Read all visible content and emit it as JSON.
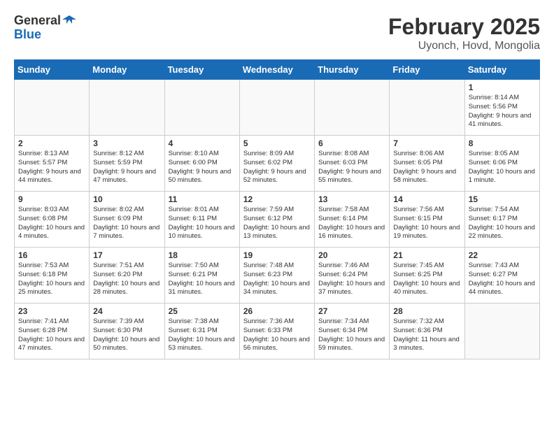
{
  "header": {
    "logo_line1": "General",
    "logo_line2": "Blue",
    "title": "February 2025",
    "subtitle": "Uyonch, Hovd, Mongolia"
  },
  "weekdays": [
    "Sunday",
    "Monday",
    "Tuesday",
    "Wednesday",
    "Thursday",
    "Friday",
    "Saturday"
  ],
  "weeks": [
    [
      {
        "day": "",
        "info": ""
      },
      {
        "day": "",
        "info": ""
      },
      {
        "day": "",
        "info": ""
      },
      {
        "day": "",
        "info": ""
      },
      {
        "day": "",
        "info": ""
      },
      {
        "day": "",
        "info": ""
      },
      {
        "day": "1",
        "info": "Sunrise: 8:14 AM\nSunset: 5:56 PM\nDaylight: 9 hours and 41 minutes."
      }
    ],
    [
      {
        "day": "2",
        "info": "Sunrise: 8:13 AM\nSunset: 5:57 PM\nDaylight: 9 hours and 44 minutes."
      },
      {
        "day": "3",
        "info": "Sunrise: 8:12 AM\nSunset: 5:59 PM\nDaylight: 9 hours and 47 minutes."
      },
      {
        "day": "4",
        "info": "Sunrise: 8:10 AM\nSunset: 6:00 PM\nDaylight: 9 hours and 50 minutes."
      },
      {
        "day": "5",
        "info": "Sunrise: 8:09 AM\nSunset: 6:02 PM\nDaylight: 9 hours and 52 minutes."
      },
      {
        "day": "6",
        "info": "Sunrise: 8:08 AM\nSunset: 6:03 PM\nDaylight: 9 hours and 55 minutes."
      },
      {
        "day": "7",
        "info": "Sunrise: 8:06 AM\nSunset: 6:05 PM\nDaylight: 9 hours and 58 minutes."
      },
      {
        "day": "8",
        "info": "Sunrise: 8:05 AM\nSunset: 6:06 PM\nDaylight: 10 hours and 1 minute."
      }
    ],
    [
      {
        "day": "9",
        "info": "Sunrise: 8:03 AM\nSunset: 6:08 PM\nDaylight: 10 hours and 4 minutes."
      },
      {
        "day": "10",
        "info": "Sunrise: 8:02 AM\nSunset: 6:09 PM\nDaylight: 10 hours and 7 minutes."
      },
      {
        "day": "11",
        "info": "Sunrise: 8:01 AM\nSunset: 6:11 PM\nDaylight: 10 hours and 10 minutes."
      },
      {
        "day": "12",
        "info": "Sunrise: 7:59 AM\nSunset: 6:12 PM\nDaylight: 10 hours and 13 minutes."
      },
      {
        "day": "13",
        "info": "Sunrise: 7:58 AM\nSunset: 6:14 PM\nDaylight: 10 hours and 16 minutes."
      },
      {
        "day": "14",
        "info": "Sunrise: 7:56 AM\nSunset: 6:15 PM\nDaylight: 10 hours and 19 minutes."
      },
      {
        "day": "15",
        "info": "Sunrise: 7:54 AM\nSunset: 6:17 PM\nDaylight: 10 hours and 22 minutes."
      }
    ],
    [
      {
        "day": "16",
        "info": "Sunrise: 7:53 AM\nSunset: 6:18 PM\nDaylight: 10 hours and 25 minutes."
      },
      {
        "day": "17",
        "info": "Sunrise: 7:51 AM\nSunset: 6:20 PM\nDaylight: 10 hours and 28 minutes."
      },
      {
        "day": "18",
        "info": "Sunrise: 7:50 AM\nSunset: 6:21 PM\nDaylight: 10 hours and 31 minutes."
      },
      {
        "day": "19",
        "info": "Sunrise: 7:48 AM\nSunset: 6:23 PM\nDaylight: 10 hours and 34 minutes."
      },
      {
        "day": "20",
        "info": "Sunrise: 7:46 AM\nSunset: 6:24 PM\nDaylight: 10 hours and 37 minutes."
      },
      {
        "day": "21",
        "info": "Sunrise: 7:45 AM\nSunset: 6:25 PM\nDaylight: 10 hours and 40 minutes."
      },
      {
        "day": "22",
        "info": "Sunrise: 7:43 AM\nSunset: 6:27 PM\nDaylight: 10 hours and 44 minutes."
      }
    ],
    [
      {
        "day": "23",
        "info": "Sunrise: 7:41 AM\nSunset: 6:28 PM\nDaylight: 10 hours and 47 minutes."
      },
      {
        "day": "24",
        "info": "Sunrise: 7:39 AM\nSunset: 6:30 PM\nDaylight: 10 hours and 50 minutes."
      },
      {
        "day": "25",
        "info": "Sunrise: 7:38 AM\nSunset: 6:31 PM\nDaylight: 10 hours and 53 minutes."
      },
      {
        "day": "26",
        "info": "Sunrise: 7:36 AM\nSunset: 6:33 PM\nDaylight: 10 hours and 56 minutes."
      },
      {
        "day": "27",
        "info": "Sunrise: 7:34 AM\nSunset: 6:34 PM\nDaylight: 10 hours and 59 minutes."
      },
      {
        "day": "28",
        "info": "Sunrise: 7:32 AM\nSunset: 6:36 PM\nDaylight: 11 hours and 3 minutes."
      },
      {
        "day": "",
        "info": ""
      }
    ]
  ]
}
